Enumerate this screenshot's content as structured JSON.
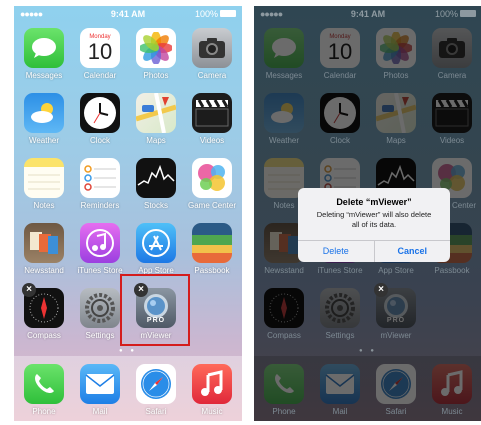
{
  "status": {
    "signal": "●●●●● ",
    "time": "9:41 AM",
    "battery": "100%"
  },
  "home": {
    "apps": [
      {
        "label": "Messages",
        "icon": "messages-icon"
      },
      {
        "label": "Calendar",
        "icon": "calendar-icon",
        "weekday": "Monday",
        "day": "10"
      },
      {
        "label": "Photos",
        "icon": "photos-icon"
      },
      {
        "label": "Camera",
        "icon": "camera-icon"
      },
      {
        "label": "Weather",
        "icon": "weather-icon"
      },
      {
        "label": "Clock",
        "icon": "clock-icon"
      },
      {
        "label": "Maps",
        "icon": "maps-icon"
      },
      {
        "label": "Videos",
        "icon": "videos-icon"
      },
      {
        "label": "Notes",
        "icon": "notes-icon"
      },
      {
        "label": "Reminders",
        "icon": "reminders-icon"
      },
      {
        "label": "Stocks",
        "icon": "stocks-icon"
      },
      {
        "label": "Game Center",
        "icon": "game-center-icon"
      },
      {
        "label": "Newsstand",
        "icon": "newsstand-icon"
      },
      {
        "label": "iTunes Store",
        "icon": "itunes-icon"
      },
      {
        "label": "App Store",
        "icon": "app-store-icon"
      },
      {
        "label": "Passbook",
        "icon": "passbook-icon"
      },
      {
        "label": "Compass",
        "icon": "compass-icon"
      },
      {
        "label": "Settings",
        "icon": "settings-icon"
      },
      {
        "label": "mViewer",
        "icon": "mviewer-icon",
        "badge": "PRO"
      }
    ],
    "dock": [
      {
        "label": "Phone",
        "icon": "phone-icon"
      },
      {
        "label": "Mail",
        "icon": "mail-icon"
      },
      {
        "label": "Safari",
        "icon": "safari-icon"
      },
      {
        "label": "Music",
        "icon": "music-icon"
      }
    ],
    "delete_badge": "×"
  },
  "dialog": {
    "title": "Delete “mViewer”",
    "message_line1": "Deleting “mViewer” will also delete",
    "message_line2": "all of its data.",
    "delete_label": "Delete",
    "cancel_label": "Cancel"
  },
  "colors": {
    "highlight": "#d41c1c",
    "ios_blue": "#1a73e8"
  }
}
